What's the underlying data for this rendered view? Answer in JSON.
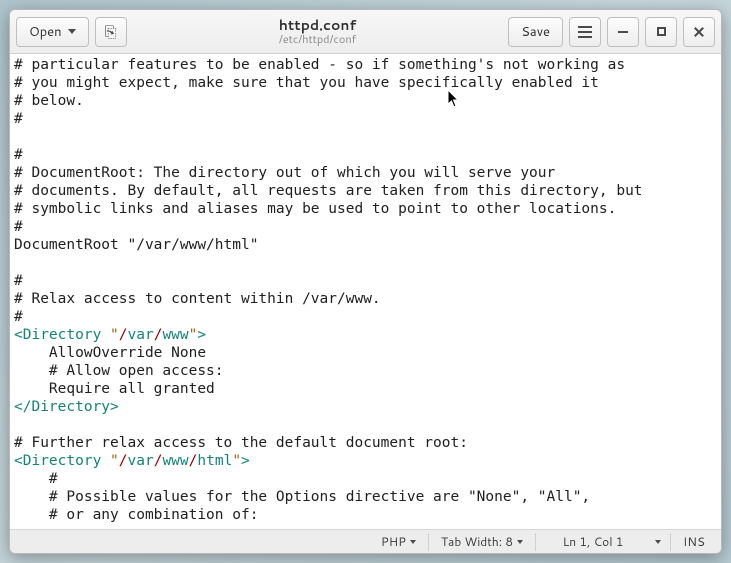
{
  "header": {
    "open_label": "Open",
    "save_label": "Save",
    "title": "httpd.conf",
    "subtitle": "/etc/httpd/conf"
  },
  "editor": {
    "lines": [
      {
        "t": "plain",
        "v": "# particular features to be enabled - so if something's not working as"
      },
      {
        "t": "plain",
        "v": "# you might expect, make sure that you have specifically enabled it"
      },
      {
        "t": "plain",
        "v": "# below."
      },
      {
        "t": "plain",
        "v": "#"
      },
      {
        "t": "plain",
        "v": ""
      },
      {
        "t": "plain",
        "v": "#"
      },
      {
        "t": "plain",
        "v": "# DocumentRoot: The directory out of which you will serve your"
      },
      {
        "t": "plain",
        "v": "# documents. By default, all requests are taken from this directory, but"
      },
      {
        "t": "plain",
        "v": "# symbolic links and aliases may be used to point to other locations."
      },
      {
        "t": "plain",
        "v": "#"
      },
      {
        "t": "plain",
        "v": "DocumentRoot \"/var/www/html\""
      },
      {
        "t": "plain",
        "v": ""
      },
      {
        "t": "plain",
        "v": "#"
      },
      {
        "t": "plain",
        "v": "# Relax access to content within /var/www."
      },
      {
        "t": "plain",
        "v": "#"
      },
      {
        "t": "dir-open",
        "tag": "Directory",
        "path": [
          "var",
          "www"
        ]
      },
      {
        "t": "plain",
        "v": "    AllowOverride None"
      },
      {
        "t": "plain",
        "v": "    # Allow open access:"
      },
      {
        "t": "plain",
        "v": "    Require all granted"
      },
      {
        "t": "dir-close",
        "tag": "Directory"
      },
      {
        "t": "plain",
        "v": ""
      },
      {
        "t": "plain",
        "v": "# Further relax access to the default document root:"
      },
      {
        "t": "dir-open",
        "tag": "Directory",
        "path": [
          "var",
          "www",
          "html"
        ]
      },
      {
        "t": "plain",
        "v": "    #"
      },
      {
        "t": "plain",
        "v": "    # Possible values for the Options directive are \"None\", \"All\","
      },
      {
        "t": "plain",
        "v": "    # or any combination of:"
      }
    ]
  },
  "status": {
    "language": "PHP",
    "tab_width_label": "Tab Width: 8",
    "cursor": "Ln 1, Col 1",
    "insert_mode": "INS"
  }
}
